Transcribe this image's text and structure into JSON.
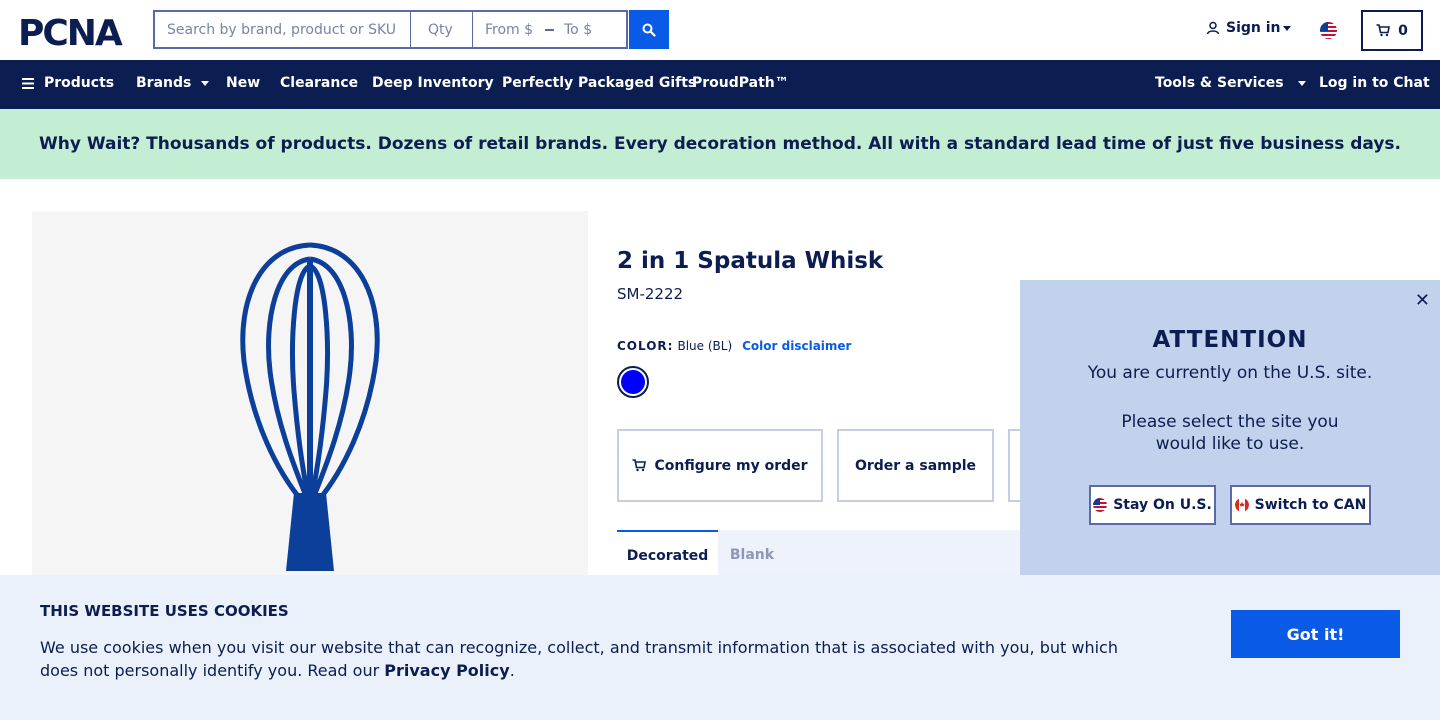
{
  "header": {
    "logo_text": "PCNA",
    "search_placeholder": "Search by brand, product or SKU",
    "qty_placeholder": "Qty",
    "price_from_placeholder": "From $",
    "price_to_placeholder": "To $",
    "signin_label": "Sign in",
    "cart_count": "0"
  },
  "nav": {
    "products": "Products",
    "brands": "Brands",
    "new": "New",
    "clearance": "Clearance",
    "deep_inventory": "Deep Inventory",
    "gifts": "Perfectly Packaged Gifts",
    "proudpath": "ProudPath™",
    "tools": "Tools & Services",
    "chat": "Log in to Chat"
  },
  "promo": {
    "text": "Why Wait? Thousands of products. Dozens of retail brands. Every decoration method. All with a standard lead time of just five business days."
  },
  "product": {
    "title": "2 in 1 Spatula Whisk",
    "sku": "SM-2222",
    "color_label": "COLOR:",
    "color_value": "Blue (BL)",
    "color_disclaimer": "Color disclaimer",
    "swatch_color": "#0000ff",
    "configure_label": "Configure my order",
    "sample_label": "Order a sample",
    "tabs": [
      {
        "label": "Decorated"
      },
      {
        "label": "Blank"
      }
    ]
  },
  "site_modal": {
    "title": "ATTENTION",
    "line1": "You are currently on the U.S. site.",
    "line2": "Please select the site you",
    "line3": "would like to use.",
    "stay_label": "Stay On U.S.",
    "switch_label": "Switch to CAN",
    "close_glyph": "✕"
  },
  "cookie": {
    "title": "THIS WEBSITE USES COOKIES",
    "text_before": "We use cookies when you visit our website that can recognize, collect, and transmit information that is associated with you, but which does not personally identify you. Read our ",
    "link": "Privacy Policy",
    "text_after": ".",
    "button": "Got it!"
  },
  "colors": {
    "navy": "#0b1d51",
    "accent": "#0a5ae8",
    "promo_bg": "#c3eed4",
    "modal_bg": "#c2d2ec",
    "cookie_bg": "#eaf1fb"
  }
}
